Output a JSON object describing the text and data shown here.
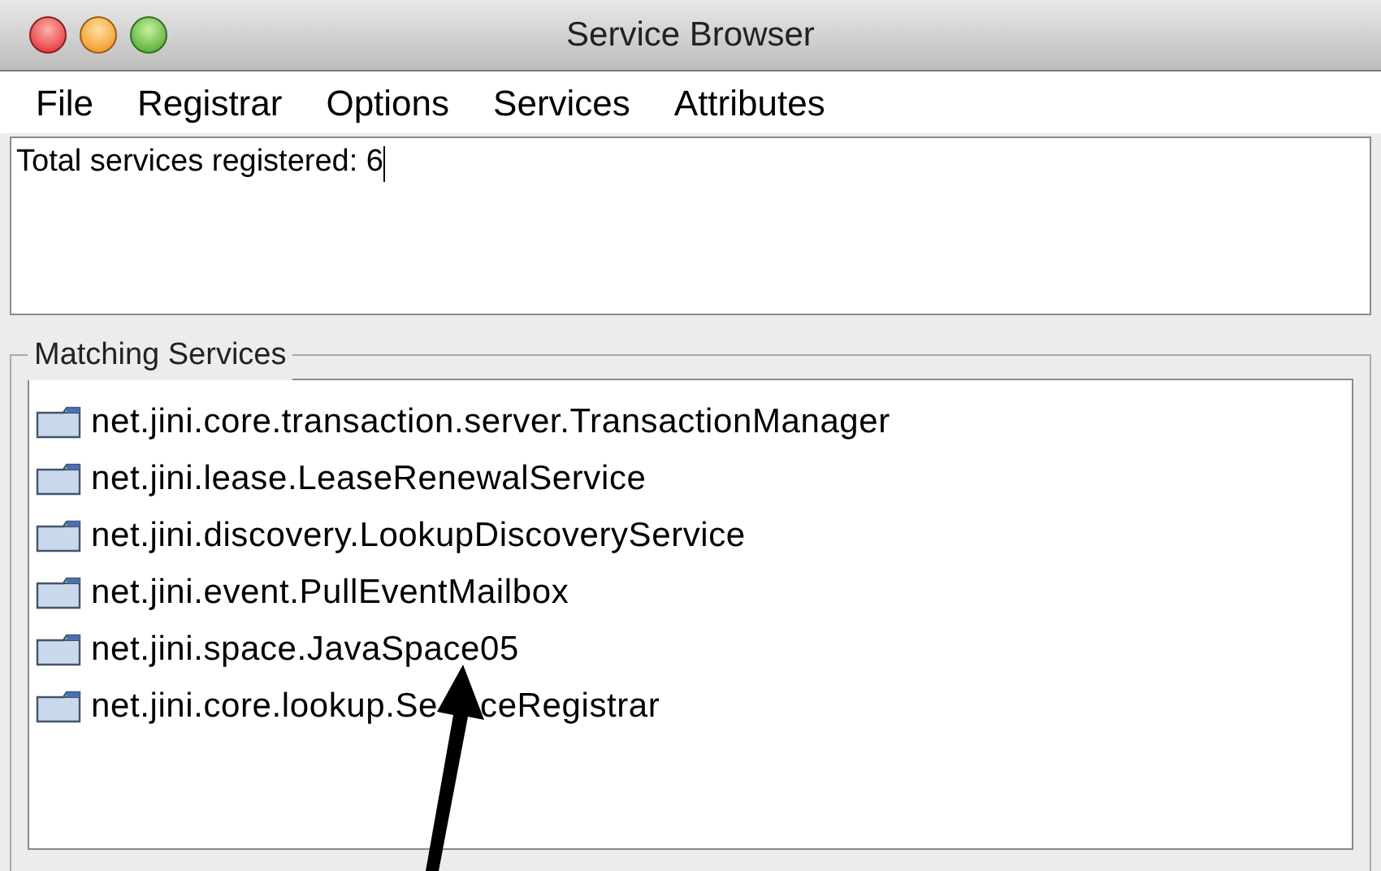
{
  "window": {
    "title": "Service Browser"
  },
  "menu": [
    "File",
    "Registrar",
    "Options",
    "Services",
    "Attributes"
  ],
  "text_area": {
    "value": "Total services registered: 6"
  },
  "matching_services": {
    "title": "Matching Services",
    "items": [
      {
        "label": "net.jini.core.transaction.server.TransactionManager"
      },
      {
        "label": "net.jini.lease.LeaseRenewalService"
      },
      {
        "label": "net.jini.discovery.LookupDiscoveryService"
      },
      {
        "label": "net.jini.event.PullEventMailbox"
      },
      {
        "label": "net.jini.space.JavaSpace05"
      },
      {
        "label": "net.jini.core.lookup.Se",
        "label_after_arrow": "ceRegistrar"
      }
    ]
  }
}
